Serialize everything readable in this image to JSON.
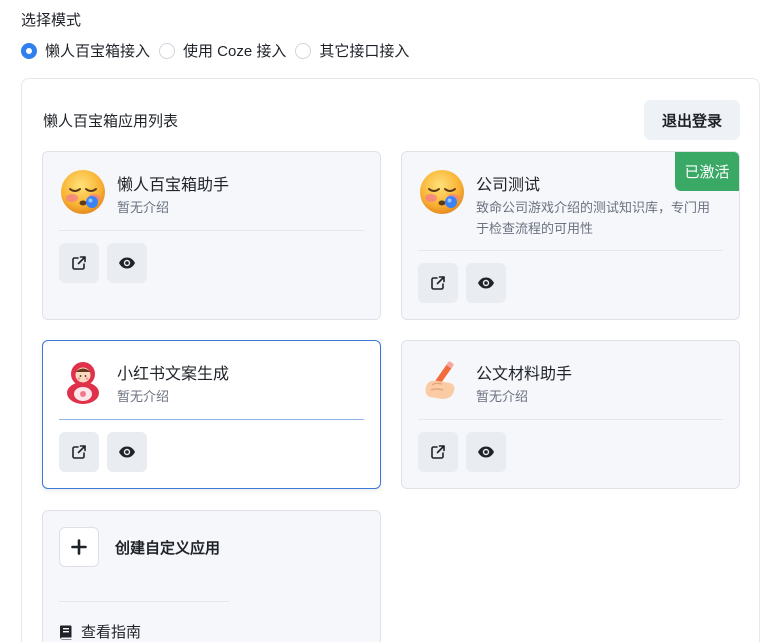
{
  "mode": {
    "title": "选择模式",
    "options": [
      {
        "label": "懒人百宝箱接入",
        "checked": true
      },
      {
        "label": "使用 Coze 接入",
        "checked": false
      },
      {
        "label": "其它接口接入",
        "checked": false
      }
    ]
  },
  "panel": {
    "title": "懒人百宝箱应用列表",
    "logout_label": "退出登录"
  },
  "apps": [
    {
      "name": "懒人百宝箱助手",
      "desc": "暂无介绍",
      "avatar": "sleepy-face-icon",
      "active": false,
      "selected": false
    },
    {
      "name": "公司测试",
      "desc": "致命公司游戏介绍的测试知识库，专门用于检查流程的可用性",
      "avatar": "sleepy-face-icon",
      "active": true,
      "selected": false
    },
    {
      "name": "小红书文案生成",
      "desc": "暂无介绍",
      "avatar": "nesting-doll-icon",
      "active": false,
      "selected": true
    },
    {
      "name": "公文材料助手",
      "desc": "暂无介绍",
      "avatar": "writing-hand-icon",
      "active": false,
      "selected": false
    }
  ],
  "active_badge": "已激活",
  "create": {
    "label": "创建自定义应用",
    "guide_label": "查看指南"
  },
  "colors": {
    "accent": "#2f80ed",
    "active_badge": "#3aa966",
    "selected_border": "#3a78d4",
    "card_bg": "#f5f7fa"
  }
}
